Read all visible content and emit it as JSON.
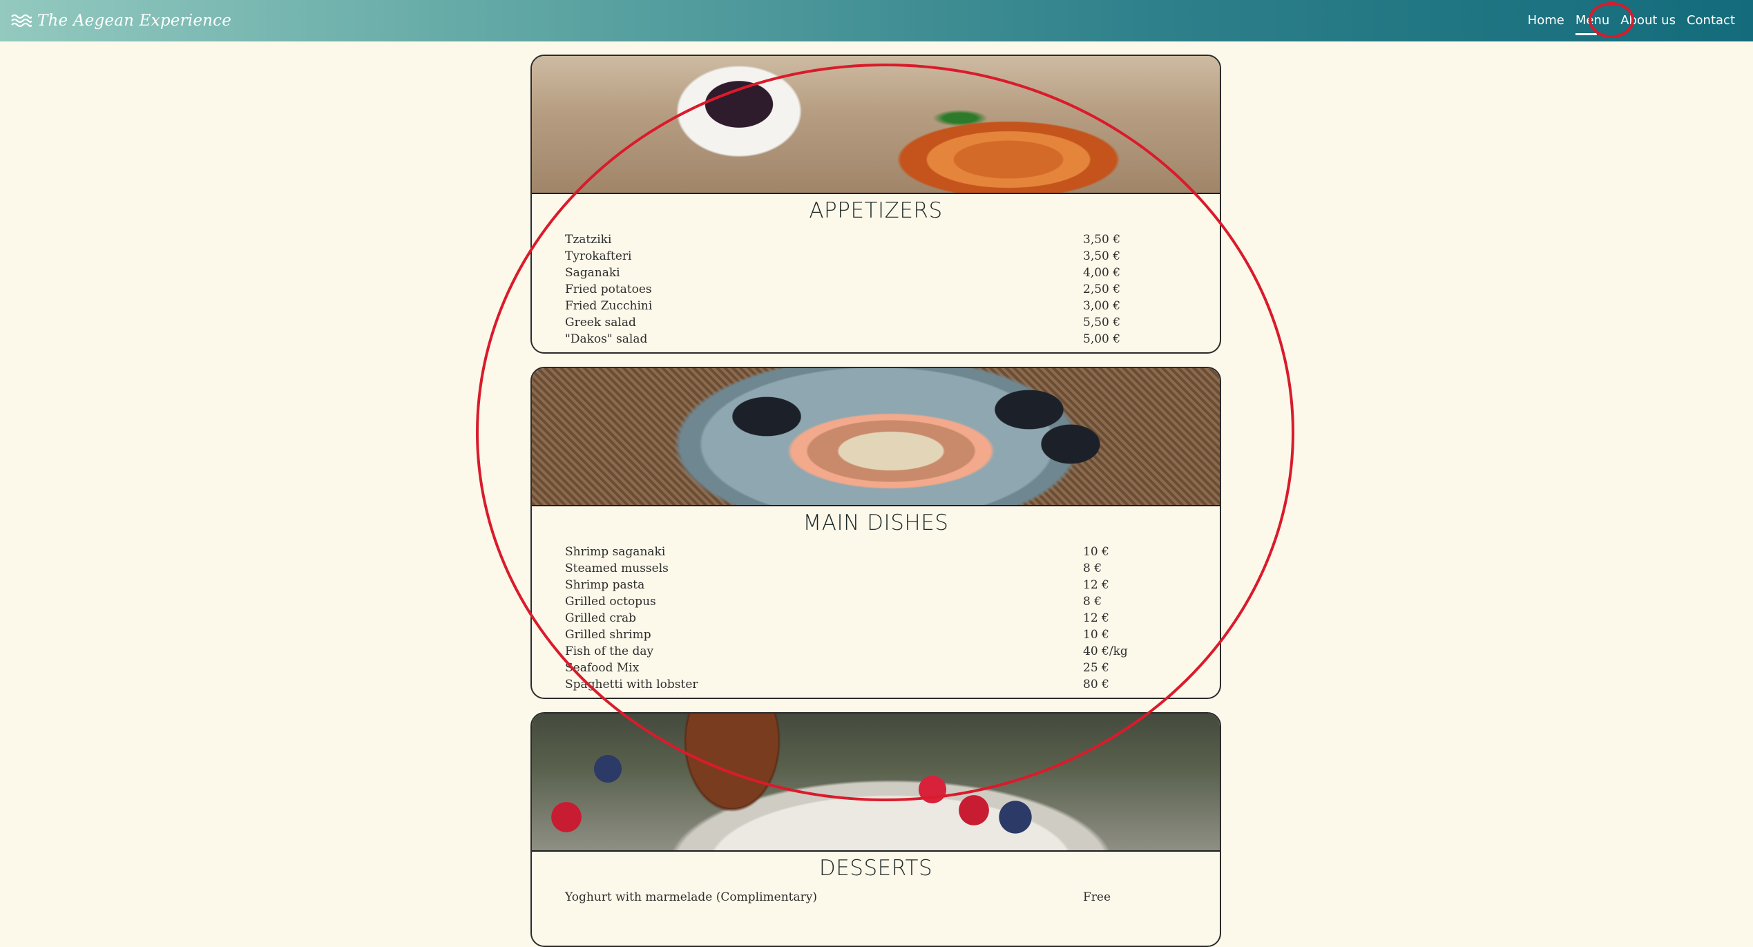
{
  "nav": {
    "brand": "The Aegean Experience",
    "links": [
      {
        "label": "Home"
      },
      {
        "label": "Menu"
      },
      {
        "label": "About us"
      },
      {
        "label": "Contact"
      }
    ]
  },
  "sections": [
    {
      "title": "APPETIZERS",
      "items": [
        {
          "name": "Tzatziki",
          "price": "3,50 €"
        },
        {
          "name": "Tyrokafteri",
          "price": "3,50 €"
        },
        {
          "name": "Saganaki",
          "price": "4,00 €"
        },
        {
          "name": "Fried potatoes",
          "price": "2,50 €"
        },
        {
          "name": "Fried Zucchini",
          "price": "3,00 €"
        },
        {
          "name": "Greek salad",
          "price": "5,50 €"
        },
        {
          "name": "\"Dakos\" salad",
          "price": "5,00 €"
        }
      ]
    },
    {
      "title": "MAIN DISHES",
      "items": [
        {
          "name": "Shrimp saganaki",
          "price": "10 €"
        },
        {
          "name": "Steamed mussels",
          "price": "8 €"
        },
        {
          "name": "Shrimp pasta",
          "price": "12 €"
        },
        {
          "name": "Grilled octopus",
          "price": "8 €"
        },
        {
          "name": "Grilled crab",
          "price": "12 €"
        },
        {
          "name": "Grilled shrimp",
          "price": "10 €"
        },
        {
          "name": "Fish of the day",
          "price": "40 €/kg"
        },
        {
          "name": "Seafood Mix",
          "price": "25 €"
        },
        {
          "name": "Spaghetti with lobster",
          "price": "80 €"
        }
      ]
    },
    {
      "title": "DESSERTS",
      "items": [
        {
          "name": "Yoghurt with marmelade (Complimentary)",
          "price": "Free"
        }
      ]
    }
  ],
  "colors": {
    "page_background": "#fcf8ea",
    "nav_gradient_start": "#93c9bf",
    "nav_gradient_end": "#136b7b",
    "annotation": "#d91b2b"
  }
}
